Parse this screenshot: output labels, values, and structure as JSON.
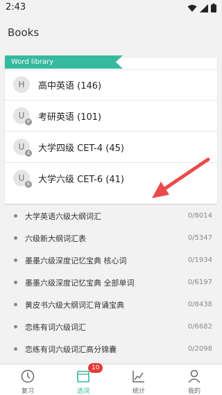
{
  "status": {
    "time": "2:43"
  },
  "header": {
    "title": "Books"
  },
  "library": {
    "ribbon_label": "Word library",
    "books": [
      {
        "initial": "",
        "label": "",
        "icon": "book-circle"
      },
      {
        "initial": "H",
        "label": "高中英语 (146)"
      },
      {
        "initial": "U",
        "sub": "P",
        "label": "考研英语 (101)"
      },
      {
        "initial": "U",
        "sub": "4",
        "label": "大学四级 CET-4 (45)"
      },
      {
        "initial": "U",
        "sub": "6",
        "label": "大学六级 CET-6 (41)"
      }
    ]
  },
  "wordlists": [
    {
      "label": "大学英语六级大纲词汇",
      "count": "0/8014"
    },
    {
      "label": "六级新大纲词汇表",
      "count": "0/5347"
    },
    {
      "label": "墨墨六级深度记忆宝典 核心词",
      "count": "0/1934"
    },
    {
      "label": "墨墨六级深度记忆宝典 全部单词",
      "count": "0/6197"
    },
    {
      "label": "黄皮书六级大纲词汇背诵宝典",
      "count": "0/8438"
    },
    {
      "label": "恋练有词六级词汇",
      "count": "0/6682"
    },
    {
      "label": "恋练有词六级词汇高分锦囊",
      "count": "0/2098"
    }
  ],
  "tabs": [
    {
      "label": "复习",
      "icon": "clock-icon"
    },
    {
      "label": "选词",
      "icon": "book-icon",
      "badge": "10",
      "active": true
    },
    {
      "label": "统计",
      "icon": "chart-icon"
    },
    {
      "label": "我的",
      "icon": "person-icon"
    }
  ],
  "colors": {
    "accent": "#35b99f",
    "badge": "#e53935",
    "arrow": "#e94b4b"
  }
}
